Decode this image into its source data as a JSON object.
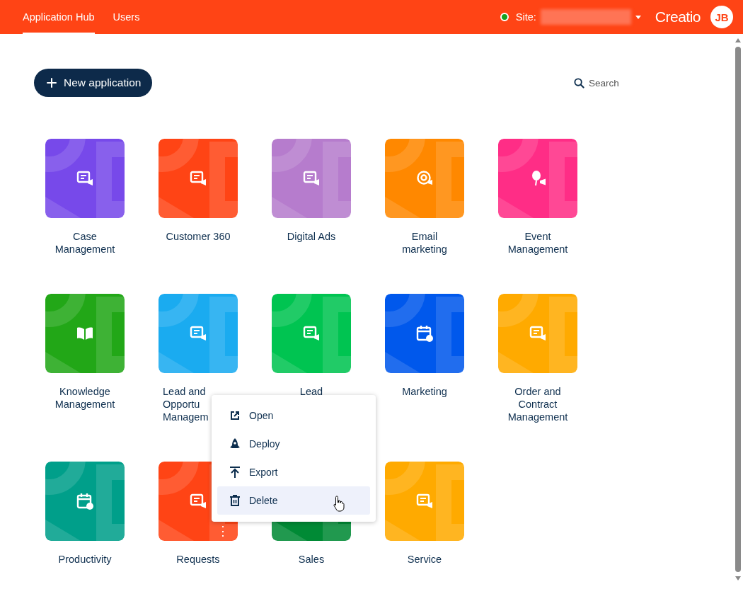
{
  "header": {
    "tabs": [
      {
        "label": "Application Hub",
        "selected": true
      },
      {
        "label": "Users",
        "selected": false
      }
    ],
    "status": {
      "color": "#14a01e"
    },
    "site_label": "Site:",
    "brand": "Creatio",
    "avatar": "JB"
  },
  "toolbar": {
    "new_button": "New application",
    "search": {
      "placeholder": "Search"
    }
  },
  "apps": [
    {
      "label": [
        "Case",
        "Management"
      ],
      "color": "#7749ea"
    },
    {
      "label": [
        "Customer 360"
      ],
      "color": "#ff4415"
    },
    {
      "label": [
        "Digital Ads"
      ],
      "color": "#b67ccd"
    },
    {
      "label": [
        "Email",
        "marketing"
      ],
      "color": "#ff8800"
    },
    {
      "label": [
        "Event",
        "Management"
      ],
      "color": "#ff2d86"
    },
    {
      "label": [
        "Knowledge",
        "Management"
      ],
      "color": "#22a717"
    },
    {
      "label": [
        "Lead and",
        "Opportu",
        "Managem"
      ],
      "color": "#1aabf0",
      "clipped": true
    },
    {
      "label": [
        "Lead"
      ],
      "color": "#00c451"
    },
    {
      "label": [
        "Marketing"
      ],
      "color": "#0058ec"
    },
    {
      "label": [
        "Order and",
        "Contract",
        "Management"
      ],
      "color": "#ffaa00"
    },
    {
      "label": [
        "Productivity"
      ],
      "color": "#009f8a"
    },
    {
      "label": [
        "Requests"
      ],
      "color": "#ff4415",
      "more": "⋮"
    },
    {
      "label": [
        "Sales"
      ],
      "color": "#008a35"
    },
    {
      "label": [
        "Service"
      ],
      "color": "#ffaa00"
    }
  ],
  "context_menu": {
    "items": [
      {
        "kind": "open",
        "label": "Open",
        "highlighted": false
      },
      {
        "kind": "deploy",
        "label": "Deploy",
        "highlighted": false
      },
      {
        "kind": "export",
        "label": "Export",
        "highlighted": false
      },
      {
        "kind": "delete",
        "label": "Delete",
        "highlighted": true
      }
    ]
  }
}
